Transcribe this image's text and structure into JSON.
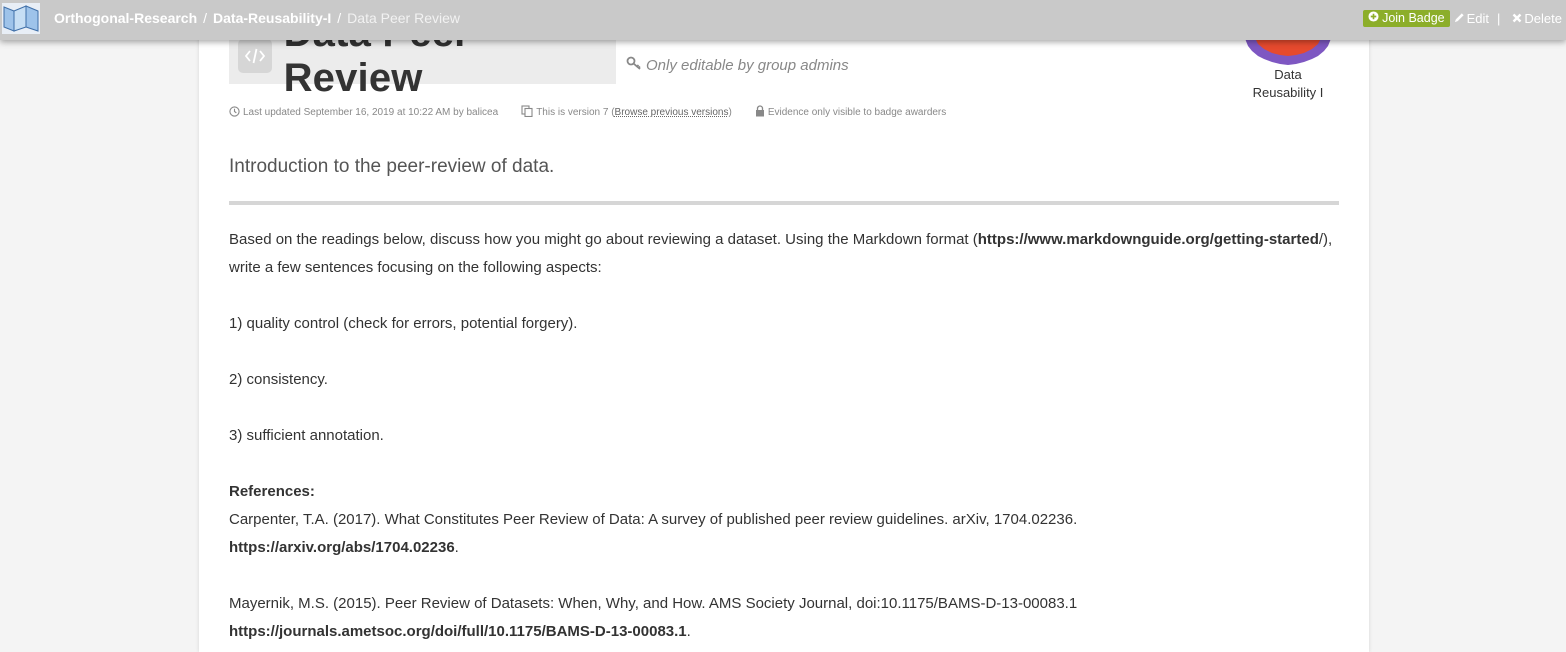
{
  "breadcrumb": {
    "items": [
      "Orthogonal-Research",
      "Data-Reusability-I"
    ],
    "current": "Data Peer Review",
    "separator": "/"
  },
  "actions": {
    "join_badge": "Join Badge",
    "edit": "Edit",
    "separator": "|",
    "delete": "Delete"
  },
  "page": {
    "title": "Data Peer Review",
    "editable_note": "Only editable by group admins",
    "badge_caption": "Data Reusability I"
  },
  "meta": {
    "updated": "Last updated September 16, 2019 at 10:22 AM by balicea",
    "version_prefix": "This is version 7 (",
    "version_link": "Browse previous versions",
    "version_suffix": ")",
    "evidence": "Evidence only visible to badge awarders"
  },
  "content": {
    "intro": "Introduction to the peer-review of data.",
    "para1_a": "Based on the readings below, discuss how you might go about reviewing a dataset. Using the Markdown format (",
    "para1_link": "https://www.markdownguide.org/getting-started",
    "para1_b": "/), write a few sentences focusing on the following aspects:",
    "item1": "1) quality control (check for errors, potential forgery).",
    "item2": "2) consistency.",
    "item3": "3) sufficient annotation.",
    "references_label": "References:",
    "ref1_text": "Carpenter, T.A. (2017). What Constitutes Peer Review of Data: A survey of published peer review guidelines. arXiv, 1704.02236.",
    "ref1_link": "https://arxiv.org/abs/1704.02236",
    "ref2_text": "Mayernik, M.S. (2015). Peer Review of Datasets: When, Why, and How. AMS Society Journal, doi:10.1175/BAMS-D-13-00083.1",
    "ref2_link": "https://journals.ametsoc.org/doi/full/10.1175/BAMS-D-13-00083.1",
    "period": "."
  },
  "colors": {
    "topbar": "#c9c9c9",
    "join_badge": "#8cae2a",
    "badge_purple": "#7e57c2",
    "badge_red": "#e64a2e"
  },
  "icons": [
    "logo-icon",
    "plus-circle-icon",
    "pencil-icon",
    "times-icon",
    "code-icon",
    "key-icon",
    "clock-icon",
    "copy-icon",
    "lock-icon"
  ]
}
